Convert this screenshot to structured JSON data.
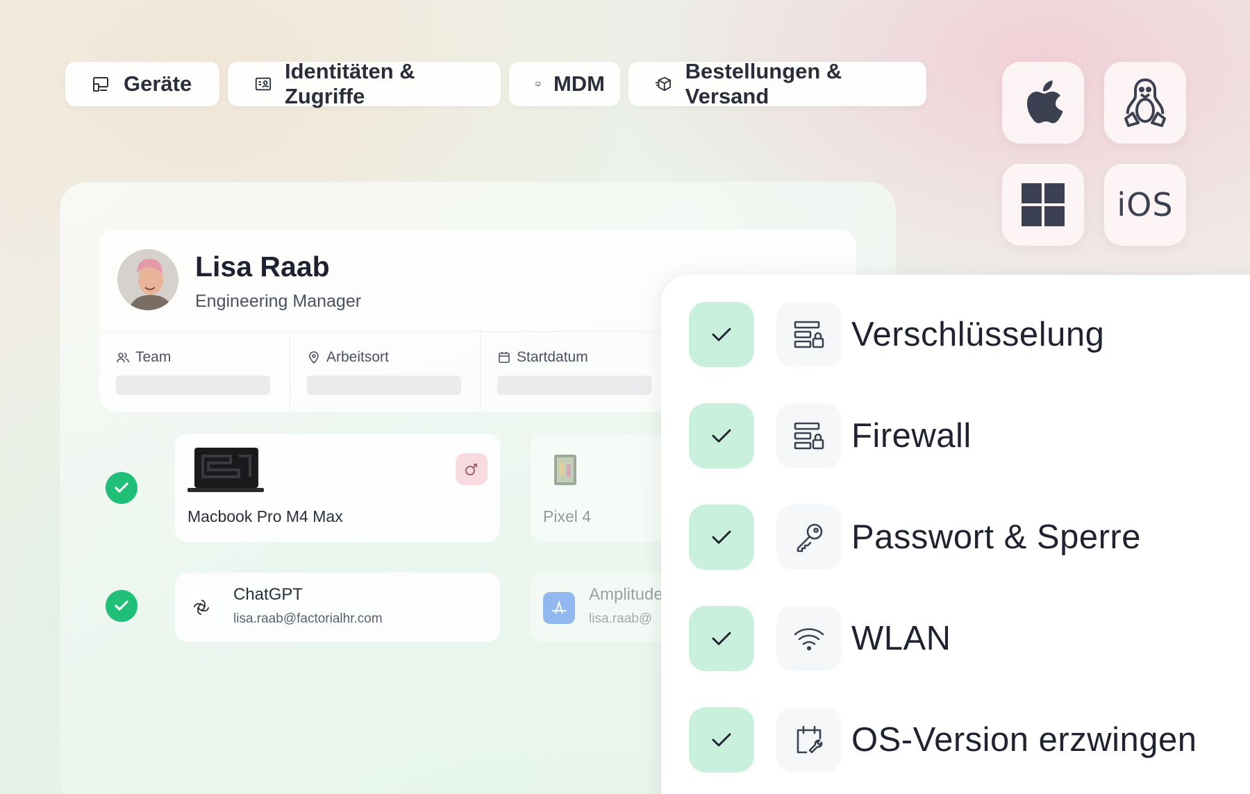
{
  "tabs": [
    {
      "label": "Geräte",
      "icon": "devices-icon"
    },
    {
      "label": "Identitäten & Zugriffe",
      "icon": "id-card-icon"
    },
    {
      "label": "MDM",
      "icon": "monitor-settings-icon"
    },
    {
      "label": "Bestellungen & Versand",
      "icon": "package-icon"
    }
  ],
  "os": [
    {
      "name": "apple",
      "icon": "apple-icon"
    },
    {
      "name": "linux",
      "icon": "linux-icon"
    },
    {
      "name": "windows",
      "icon": "windows-icon"
    },
    {
      "name": "ios",
      "label": "iOS"
    }
  ],
  "profile": {
    "name": "Lisa Raab",
    "role": "Engineering Manager",
    "fields": [
      {
        "label": "Team",
        "icon": "users-icon"
      },
      {
        "label": "Arbeitsort",
        "icon": "map-pin-icon"
      },
      {
        "label": "Startdatum",
        "icon": "calendar-icon"
      }
    ]
  },
  "devices": [
    {
      "label": "Macbook Pro M4 Max",
      "status": "ok"
    },
    {
      "label": "Pixel 4"
    }
  ],
  "apps": [
    {
      "name": "ChatGPT",
      "email": "lisa.raab@factorialhr.com",
      "status": "ok"
    },
    {
      "name": "Amplitude",
      "email": "lisa.raab@"
    }
  ],
  "security": [
    {
      "label": "Verschlüsselung",
      "icon": "server-lock-icon"
    },
    {
      "label": "Firewall",
      "icon": "server-lock-icon"
    },
    {
      "label": "Passwort & Sperre",
      "icon": "key-icon"
    },
    {
      "label": "WLAN",
      "icon": "wifi-icon"
    },
    {
      "label": "OS-Version erzwingen",
      "icon": "calendar-wrench-icon"
    }
  ],
  "colors": {
    "accent_green": "#1fbf78",
    "check_tile": "#c9f0dc",
    "text_dark": "#1f2330"
  }
}
